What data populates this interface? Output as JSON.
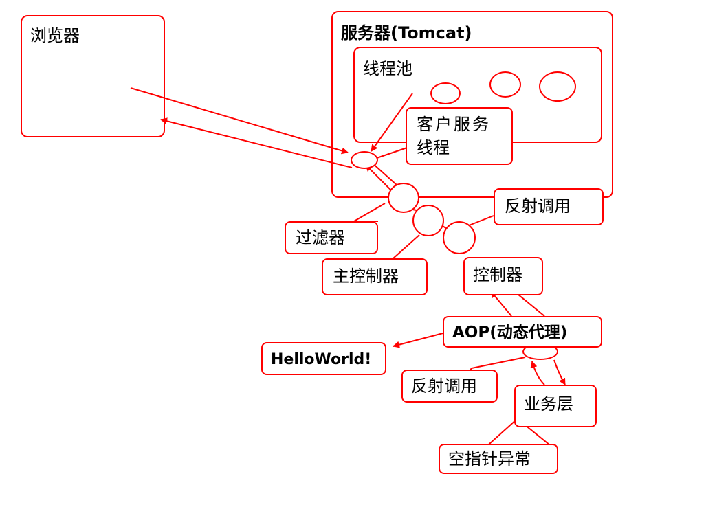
{
  "boxes": {
    "browser": {
      "title": "浏览器"
    },
    "server": {
      "title": "服务器(Tomcat)"
    },
    "thread_pool": {
      "title": "线程池"
    }
  },
  "labels": {
    "client_thread_line1": "客户服务",
    "client_thread_line2": "线程",
    "reflect_call_top": "反射调用",
    "filter": "过滤器",
    "main_controller": "主控制器",
    "controller": "控制器",
    "aop": "AOP(动态代理)",
    "hello_world": "HelloWorld!",
    "reflect_call_bottom": "反射调用",
    "business_layer": "业务层",
    "null_pointer": "空指针异常"
  },
  "colors": {
    "stroke": "#ff0000",
    "text": "#000000",
    "background": "#ffffff"
  }
}
